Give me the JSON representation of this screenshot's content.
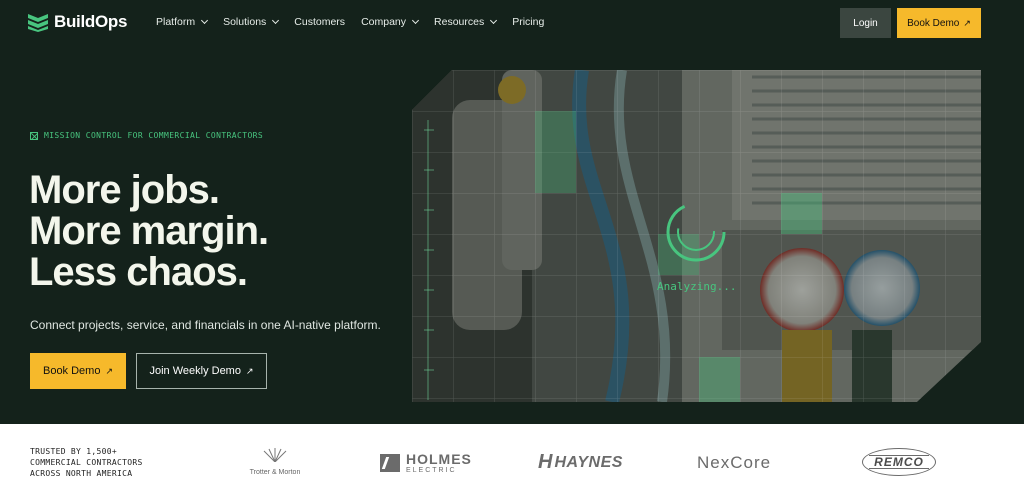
{
  "nav": {
    "brand": "BuildOps",
    "items": [
      {
        "label": "Platform",
        "dropdown": true
      },
      {
        "label": "Solutions",
        "dropdown": true
      },
      {
        "label": "Customers",
        "dropdown": false
      },
      {
        "label": "Company",
        "dropdown": true
      },
      {
        "label": "Resources",
        "dropdown": true
      },
      {
        "label": "Pricing",
        "dropdown": false
      }
    ],
    "login_label": "Login",
    "book_demo_label": "Book Demo"
  },
  "hero": {
    "eyebrow": "MISSION CONTROL FOR COMMERCIAL CONTRACTORS",
    "headline": [
      "More jobs.",
      "More margin.",
      "Less chaos."
    ],
    "subheading": "Connect projects, service, and financials in one AI-native platform.",
    "cta_primary": "Book Demo",
    "cta_secondary": "Join Weekly Demo",
    "analyzing_text": "Analyzing..."
  },
  "trusted": {
    "lines": [
      "TRUSTED BY 1,500+",
      "COMMERCIAL CONTRACTORS",
      "ACROSS NORTH AMERICA"
    ],
    "logos": {
      "trotter": "Trotter & Morton",
      "holmes_name": "HOLMES",
      "holmes_sub": "ELECTRIC",
      "haynes_mark": "H",
      "haynes_name": "HAYNES",
      "nexcore": "NexCore",
      "remco": "REMCO"
    }
  },
  "colors": {
    "background": "#14221b",
    "accent_green": "#48c57f",
    "accent_yellow": "#f6b92b",
    "headline": "#f3f6ec"
  },
  "icons": {
    "logo": "buildops-chevron-icon",
    "dropdown": "chevron-down-icon",
    "external": "arrow-up-right-icon",
    "eyebrow": "crosshair-square-icon",
    "scanner": "scanner-ring-icon"
  }
}
